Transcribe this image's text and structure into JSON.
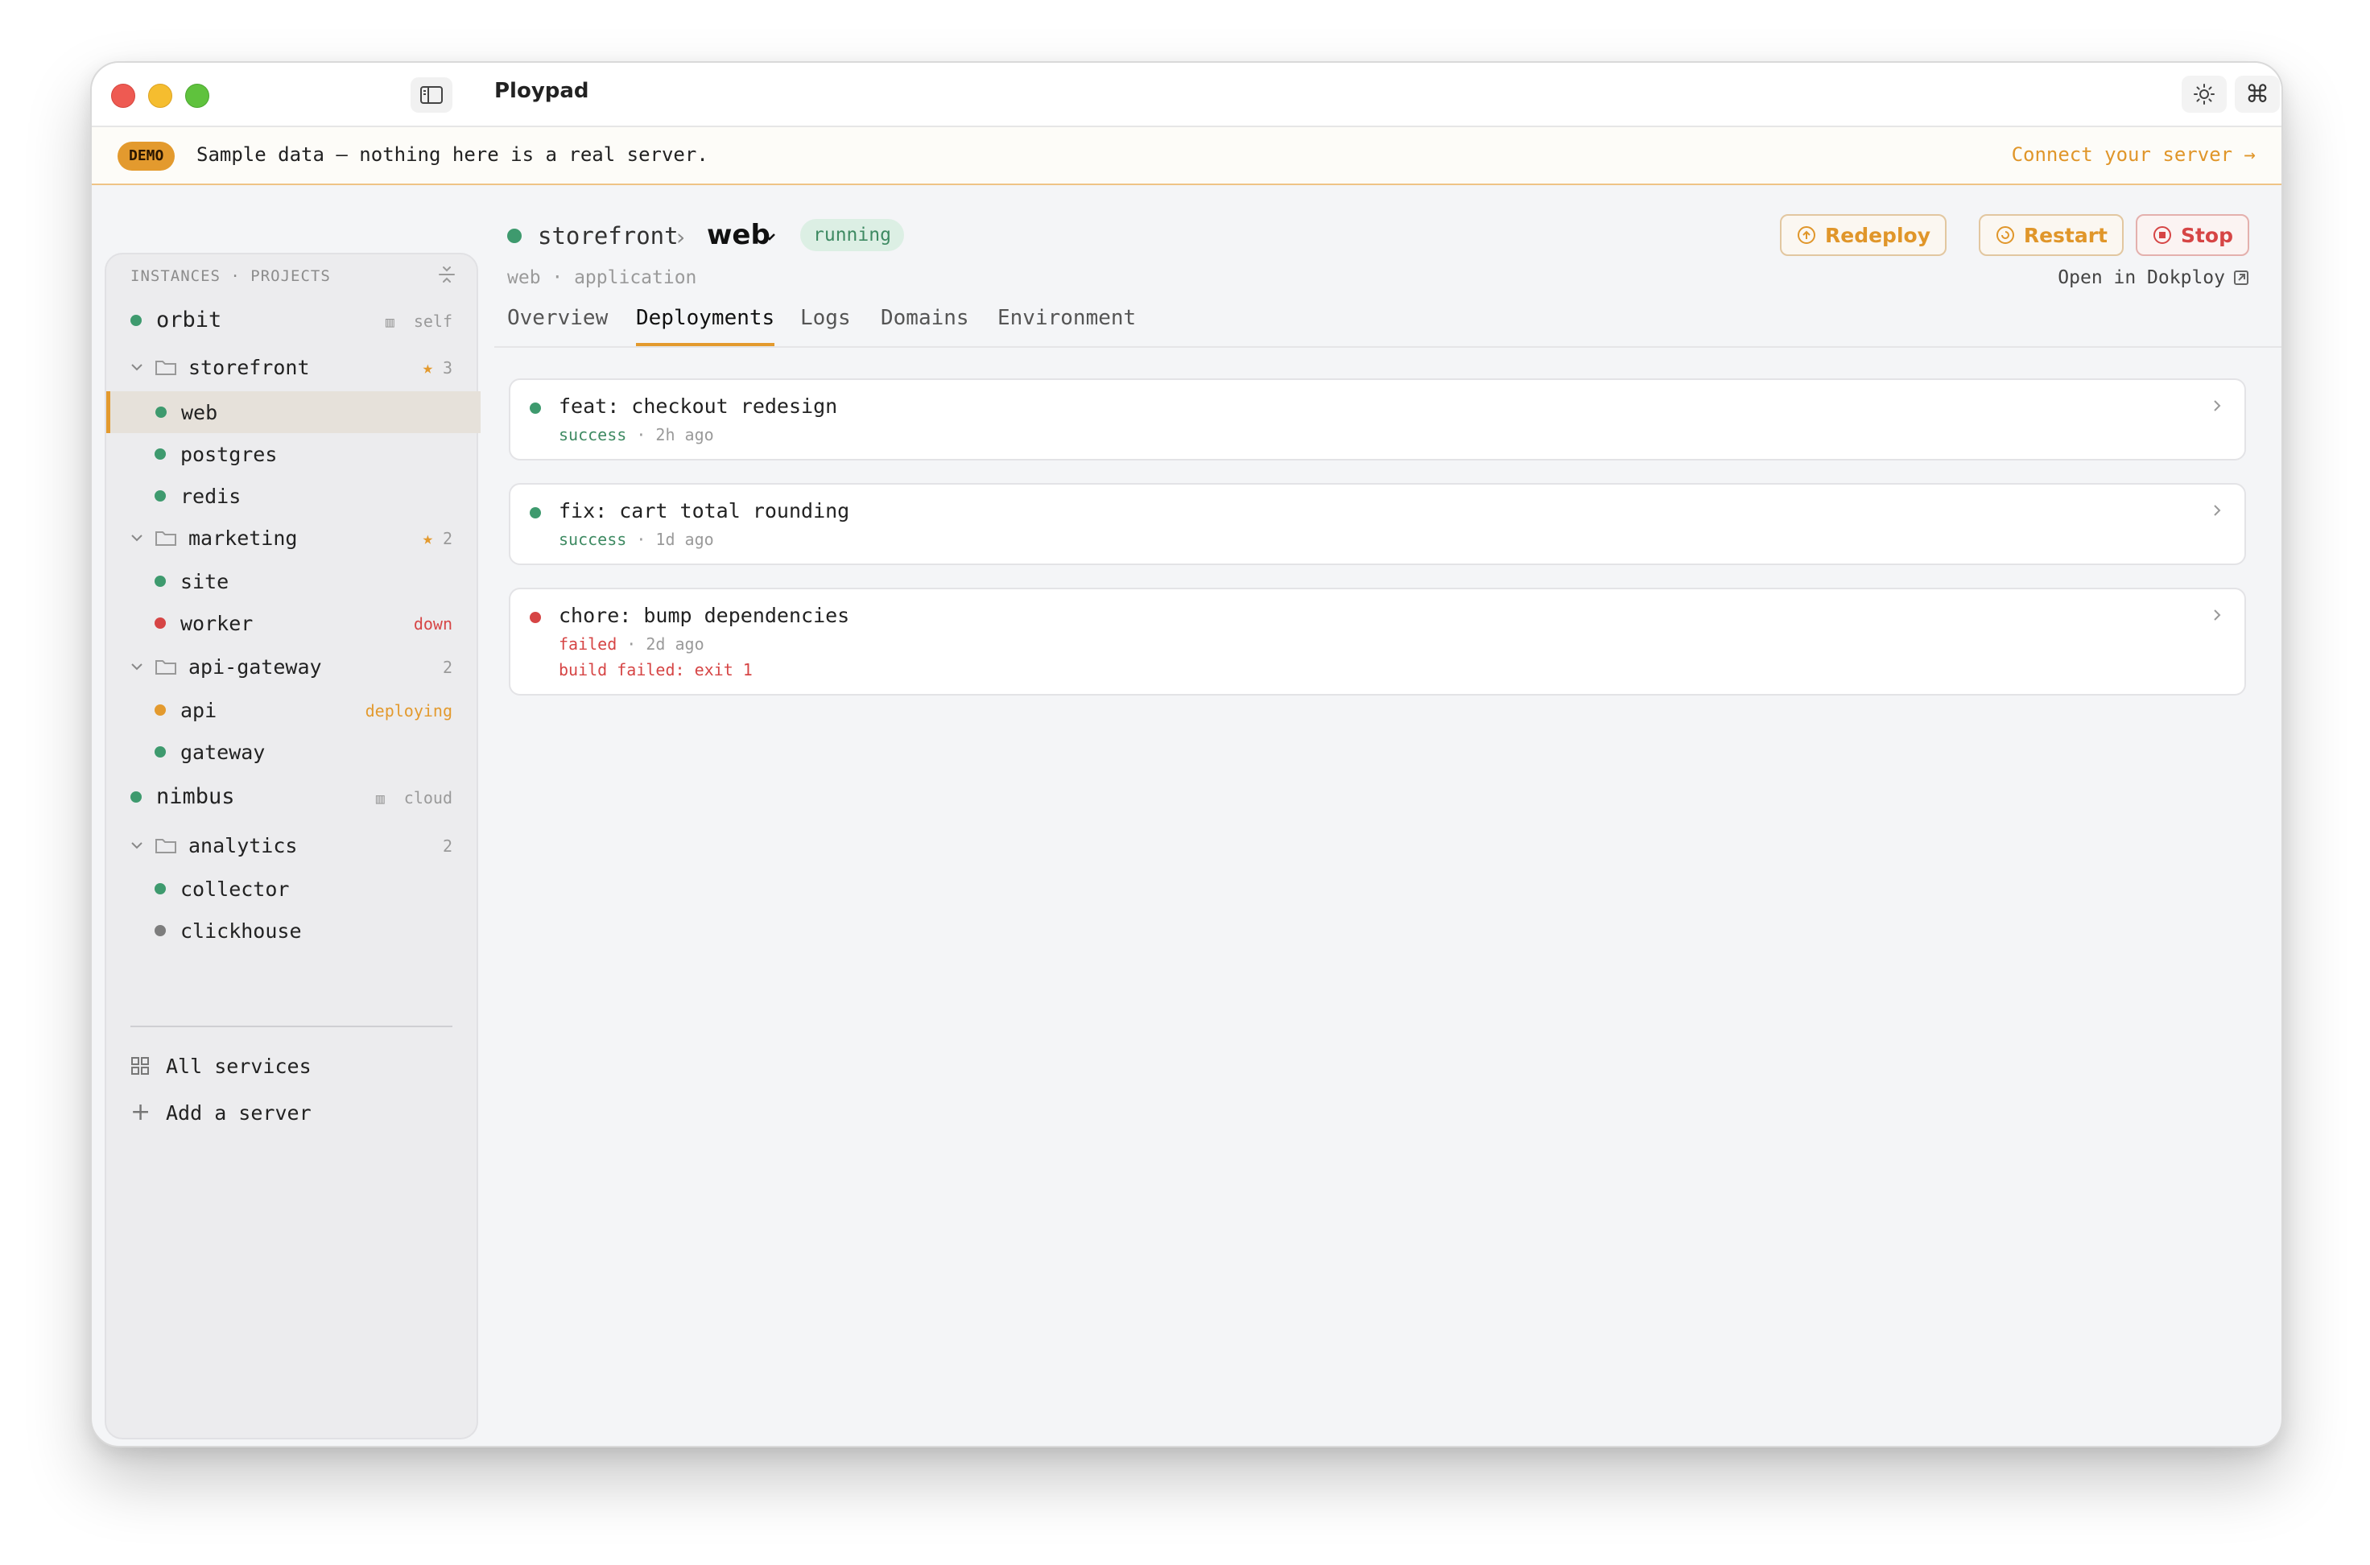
{
  "app": {
    "title": "Ploypad"
  },
  "banner": {
    "badge": "DEMO",
    "text": "Sample data — nothing here is a real server.",
    "link": "Connect your server →"
  },
  "sidebar": {
    "header": "INSTANCES · PROJECTS",
    "instances": [
      {
        "name": "orbit",
        "tag": "self",
        "status": "green"
      },
      {
        "name": "nimbus",
        "tag": "cloud",
        "status": "green"
      }
    ],
    "projects": [
      {
        "name": "storefront",
        "count": "3",
        "starred": true,
        "services": [
          {
            "name": "web",
            "status": "green",
            "note": ""
          },
          {
            "name": "postgres",
            "status": "green",
            "note": ""
          },
          {
            "name": "redis",
            "status": "green",
            "note": ""
          }
        ]
      },
      {
        "name": "marketing",
        "count": "2",
        "starred": true,
        "services": [
          {
            "name": "site",
            "status": "green",
            "note": ""
          },
          {
            "name": "worker",
            "status": "red",
            "note": "down"
          }
        ]
      },
      {
        "name": "api-gateway",
        "count": "2",
        "starred": false,
        "services": [
          {
            "name": "api",
            "status": "amber",
            "note": "deploying"
          },
          {
            "name": "gateway",
            "status": "green",
            "note": ""
          }
        ]
      },
      {
        "name": "analytics",
        "count": "2",
        "starred": false,
        "services": [
          {
            "name": "collector",
            "status": "green",
            "note": ""
          },
          {
            "name": "clickhouse",
            "status": "gray",
            "note": ""
          }
        ]
      }
    ],
    "footer": {
      "all_services": "All services",
      "add_server": "Add a server"
    }
  },
  "main": {
    "project": "storefront",
    "service": "web",
    "status": "running",
    "subtitle": "web · application",
    "actions": {
      "redeploy": "Redeploy",
      "restart": "Restart",
      "stop": "Stop"
    },
    "open_link": "Open in Dokploy",
    "tabs": [
      "Overview",
      "Deployments",
      "Logs",
      "Domains",
      "Environment"
    ],
    "active_tab": "Deployments",
    "deployments": [
      {
        "title": "feat: checkout redesign",
        "result": "success",
        "time": "2h ago",
        "error": ""
      },
      {
        "title": "fix: cart total rounding",
        "result": "success",
        "time": "1d ago",
        "error": ""
      },
      {
        "title": "chore: bump dependencies",
        "result": "failed",
        "time": "2d ago",
        "error": "build failed: exit 1"
      }
    ]
  },
  "colors": {
    "accent": "#e39a2e",
    "success": "#3e9a6e",
    "danger": "#d64545"
  }
}
